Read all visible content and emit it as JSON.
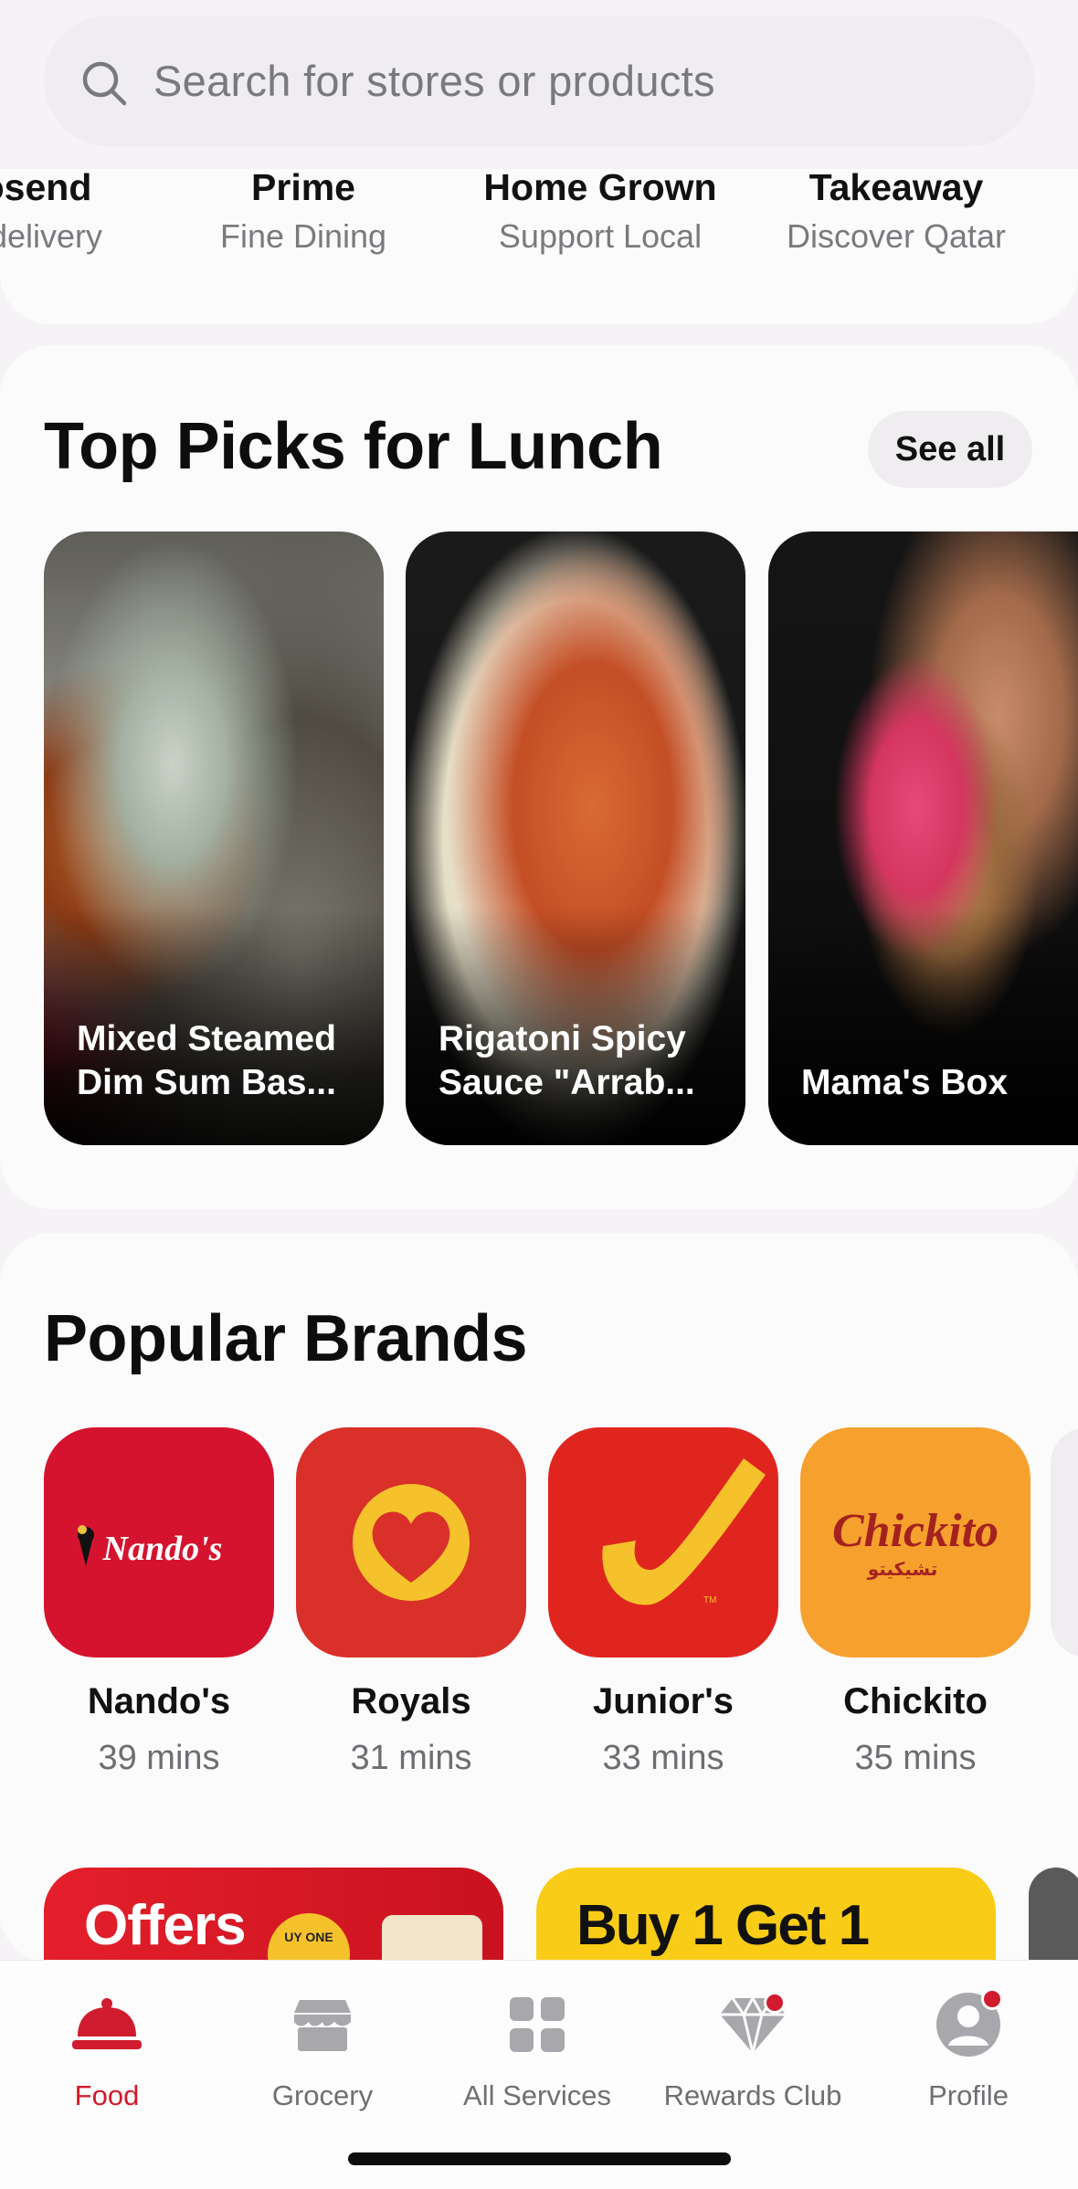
{
  "search": {
    "placeholder": "Search for stores or products"
  },
  "categories": [
    {
      "title": "osend",
      "subtitle": "t delivery"
    },
    {
      "title": "Prime",
      "subtitle": "Fine Dining"
    },
    {
      "title": "Home Grown",
      "subtitle": "Support Local"
    },
    {
      "title": "Takeaway",
      "subtitle": "Discover Qatar"
    }
  ],
  "top_picks": {
    "title": "Top Picks for Lunch",
    "see_all": "See all",
    "items": [
      {
        "caption_line1": "Mixed Steamed",
        "caption_line2": "Dim Sum Bas..."
      },
      {
        "caption_line1": "Rigatoni Spicy",
        "caption_line2": "Sauce \"Arrab..."
      },
      {
        "caption_line1": "",
        "caption_line2": "Mama's Box"
      }
    ]
  },
  "popular_brands": {
    "title": "Popular Brands",
    "items": [
      {
        "name": "Nando's",
        "time": "39 mins",
        "logo_text": "Nando's",
        "color": "#d5132f"
      },
      {
        "name": "Royals",
        "time": "31 mins",
        "color": "#d9302a"
      },
      {
        "name": "Junior's",
        "time": "33 mins",
        "color": "#e0251f"
      },
      {
        "name": "Chickito",
        "time": "35 mins",
        "logo_text": "Chickito",
        "logo_sub": "تشيكيتو",
        "color": "#f6a02e"
      }
    ]
  },
  "promos": [
    {
      "text": "Offers",
      "badge": "UY ONE"
    },
    {
      "text": "Buy 1 Get 1"
    }
  ],
  "nav": {
    "items": [
      {
        "label": "Food",
        "active": true
      },
      {
        "label": "Grocery"
      },
      {
        "label": "All Services"
      },
      {
        "label": "Rewards Club"
      },
      {
        "label": "Profile"
      }
    ]
  },
  "colors": {
    "accent": "#d11b2e",
    "background": "#f5f3f5",
    "card": "#fcfbfc"
  }
}
